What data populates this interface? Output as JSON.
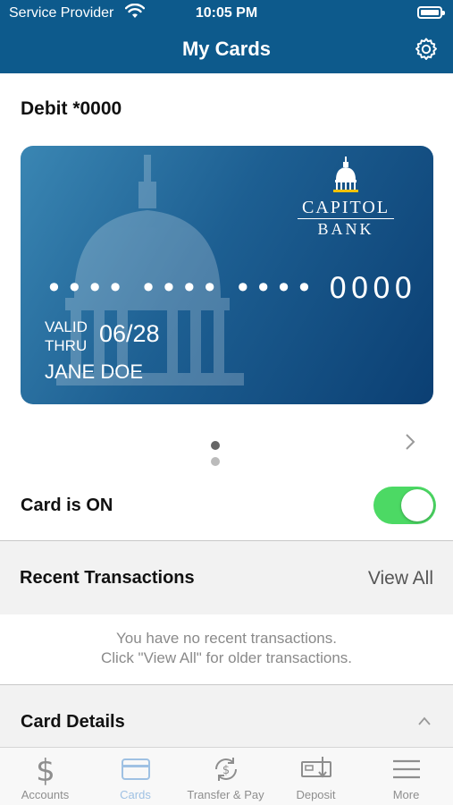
{
  "status_bar": {
    "carrier": "Service Provider",
    "time": "10:05 PM"
  },
  "header": {
    "title": "My Cards"
  },
  "card": {
    "label": "Debit *0000",
    "bank_line1": "CAPITOL",
    "bank_line2": "BANK",
    "masked_number": "•••• •••• •••• 0000",
    "valid_line1": "VALID",
    "valid_line2": "THRU",
    "expiry": "06/28",
    "holder": "JANE DOE",
    "pager": {
      "count": 2,
      "active_index": 0
    }
  },
  "card_toggle": {
    "label": "Card is ON",
    "on": true
  },
  "recent_transactions": {
    "title": "Recent Transactions",
    "view_all": "View All",
    "empty_line1": "You have no recent transactions.",
    "empty_line2": "Click \"View All\" for older transactions."
  },
  "card_details": {
    "title": "Card Details"
  },
  "tabs": [
    {
      "label": "Accounts",
      "icon": "dollar-icon",
      "active": false
    },
    {
      "label": "Cards",
      "icon": "card-icon",
      "active": true
    },
    {
      "label": "Transfer & Pay",
      "icon": "transfer-icon",
      "active": false
    },
    {
      "label": "Deposit",
      "icon": "check-deposit-icon",
      "active": false
    },
    {
      "label": "More",
      "icon": "menu-icon",
      "active": false
    }
  ],
  "colors": {
    "header_bg": "#0d5a8c",
    "toggle_on": "#4cd964",
    "tab_active": "#9fc1e3",
    "tab_inactive": "#8e8e8e"
  }
}
